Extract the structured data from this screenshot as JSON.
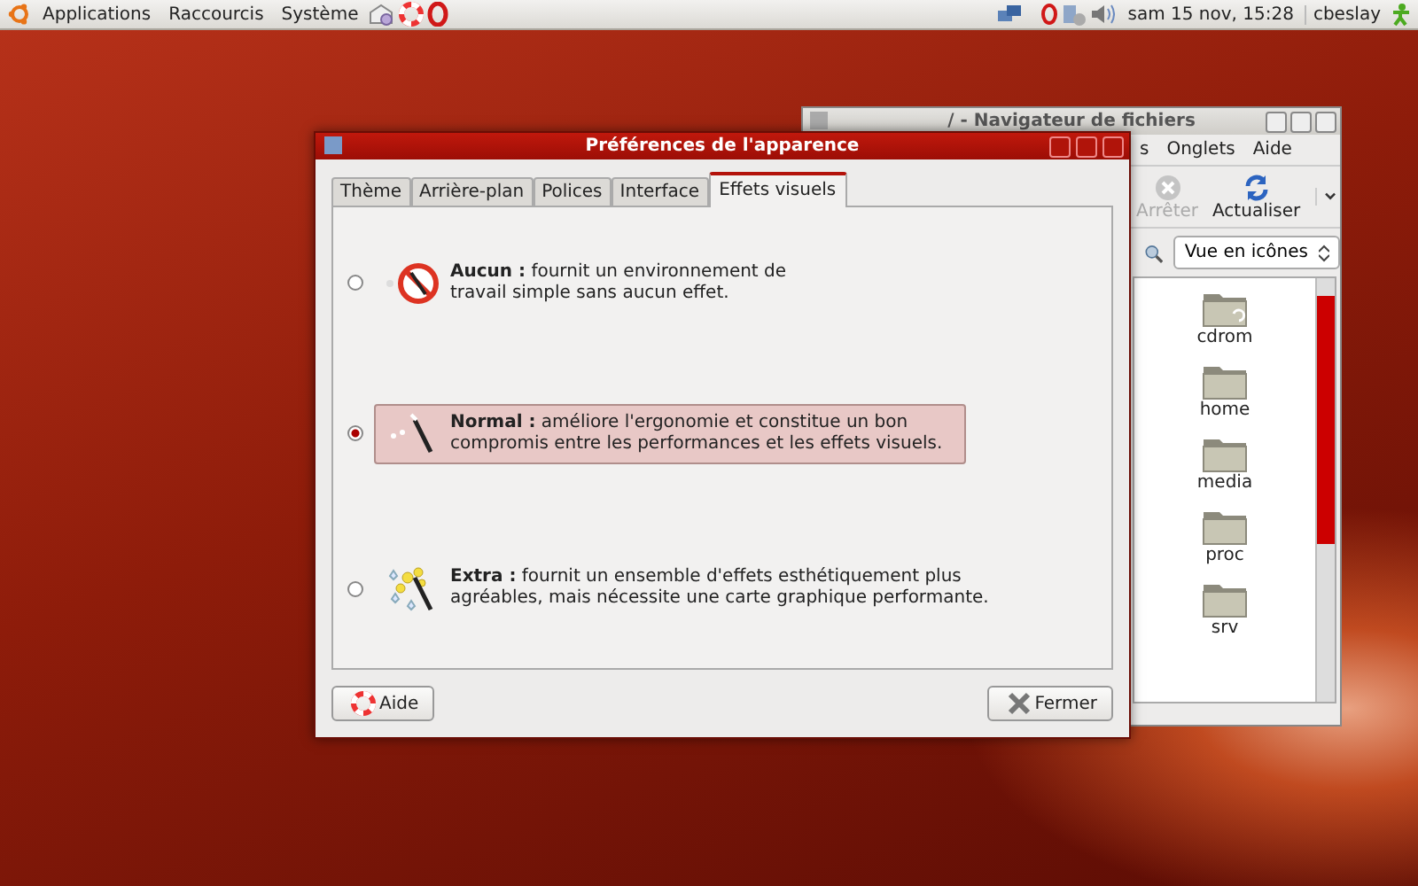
{
  "top_panel": {
    "menus": [
      "Applications",
      "Raccourcis",
      "Système"
    ],
    "clock": "sam 15 nov, 15:28",
    "user": "cbeslay"
  },
  "file_browser": {
    "title": "/ - Navigateur de fichiers",
    "menus": [
      "s",
      "Onglets",
      "Aide"
    ],
    "toolbar": [
      {
        "kind": "stop",
        "label": "Arrêter",
        "disabled": true
      },
      {
        "kind": "reload",
        "label": "Actualiser",
        "disabled": false
      }
    ],
    "view_mode": "Vue en icônes",
    "items": [
      {
        "kind": "mount",
        "name": "cdrom"
      },
      {
        "kind": "folder",
        "name": "home"
      },
      {
        "kind": "folder",
        "name": "media"
      },
      {
        "kind": "folder",
        "name": "proc"
      },
      {
        "kind": "folder",
        "name": "srv"
      }
    ]
  },
  "dialog": {
    "title": "Préférences de l'apparence",
    "tabs": [
      {
        "label": "Thème",
        "selected": false
      },
      {
        "label": "Arrière-plan",
        "selected": false
      },
      {
        "label": "Polices",
        "selected": false
      },
      {
        "label": "Interface",
        "selected": false
      },
      {
        "label": "Effets visuels",
        "selected": true
      }
    ],
    "options": [
      {
        "kind": "none",
        "selected": false,
        "lines": [
          "**Aucun :** fournit un environnement de",
          "travail simple sans aucun effet."
        ]
      },
      {
        "kind": "normal",
        "selected": true,
        "lines": [
          "**Normal :** améliore l'ergonomie et constitue un bon",
          "compromis entre les performances et les effets visuels."
        ]
      },
      {
        "kind": "extra",
        "selected": false,
        "lines": [
          "**Extra :** fournit un ensemble d'effets esthétiquement plus",
          "agréables, mais nécessite une carte graphique performante."
        ]
      }
    ],
    "buttons": [
      {
        "kind": "help",
        "label": "Aide"
      },
      {
        "kind": "close",
        "label": "Fermer"
      }
    ]
  }
}
